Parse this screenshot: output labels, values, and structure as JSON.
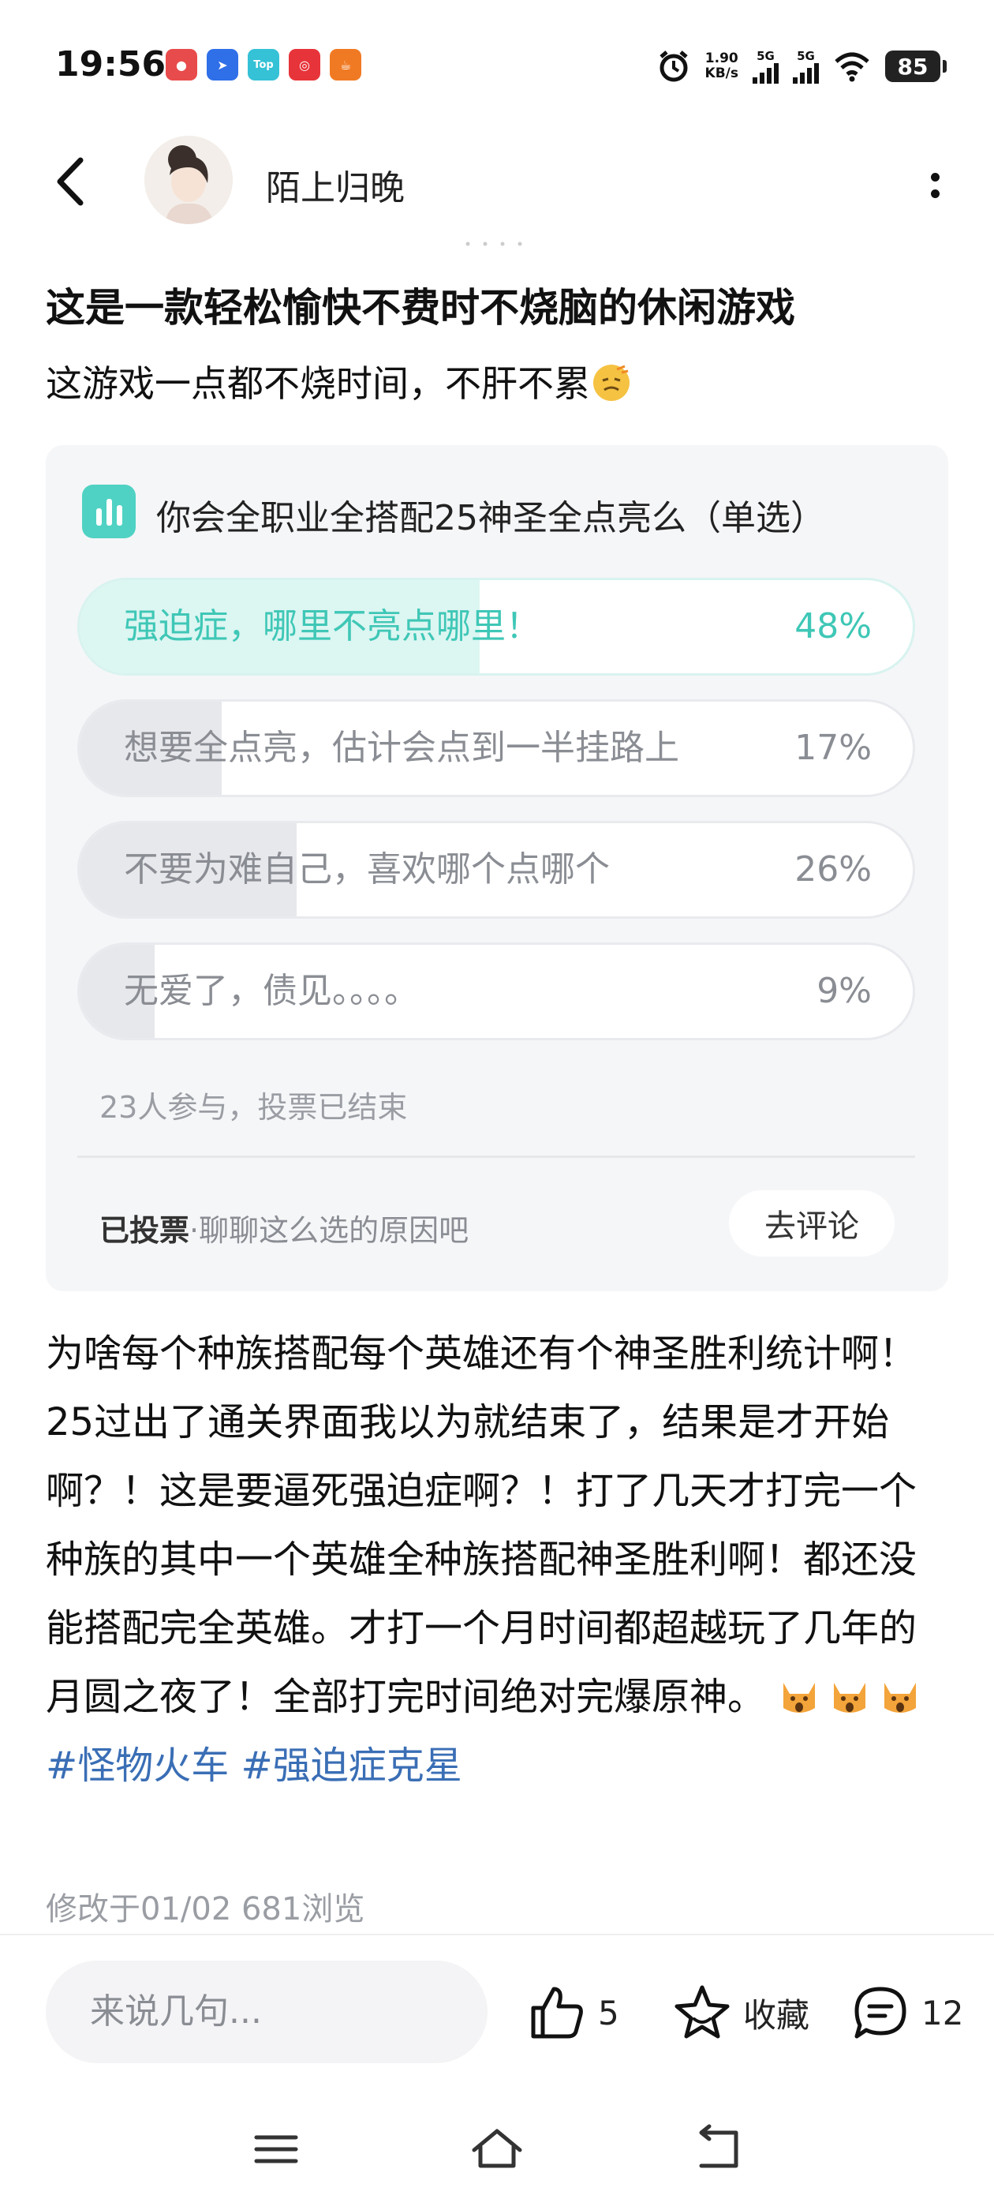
{
  "status_bar": {
    "time": "19:56",
    "net_speed_value": "1.90",
    "net_speed_unit": "KB/s",
    "sim1": "5G",
    "sim2": "5G",
    "battery": "85",
    "app_icons": [
      "grocery-app-icon",
      "navigation-app-icon",
      "top-app-icon",
      "music-app-icon",
      "cup-app-icon"
    ]
  },
  "header": {
    "username": "陌上归晚"
  },
  "post": {
    "title": "这是一款轻松愉快不费时不烧脑的休闲游戏",
    "subtitle": "这游戏一点都不烧时间，不肝不累"
  },
  "poll": {
    "question": "你会全职业全搭配25神圣全点亮么（单选）",
    "options": [
      {
        "label": "强迫症，哪里不亮点哪里！",
        "percent_text": "48%",
        "fraction": 0.48,
        "selected": true
      },
      {
        "label": "想要全点亮，估计会点到一半挂路上",
        "percent_text": "17%",
        "fraction": 0.17,
        "selected": false
      },
      {
        "label": "不要为难自己，喜欢哪个点哪个",
        "percent_text": "26%",
        "fraction": 0.26,
        "selected": false
      },
      {
        "label": "无爱了，债见。。。。",
        "percent_text": "9%",
        "fraction": 0.09,
        "selected": false
      }
    ],
    "meta": "23人参与，投票已结束",
    "voted_label": "已投票",
    "voted_hint": "·聊聊这么选的原因吧",
    "comment_button": "去评论"
  },
  "body": {
    "text": "为啥每个种族搭配每个英雄还有个神圣胜利统计啊！25过出了通关界面我以为就结束了，结果是才开始啊？！这是要逼死强迫症啊？！打了几天才打完一个种族的其中一个英雄全种族搭配神圣胜利啊！都还没能搭配完全英雄。才打一个月时间都超越玩了几年的月圆之夜了！全部打完时间绝对完爆原神。",
    "tags": [
      "#怪物火车",
      "#强迫症克星"
    ]
  },
  "footer": {
    "meta": "修改于01/02  681浏览"
  },
  "action_bar": {
    "input_placeholder": "来说几句...",
    "like_count": "5",
    "favorite_label": "收藏",
    "comment_count": "12"
  },
  "colors": {
    "accent": "#3fc7b6",
    "tag": "#3a6eb5",
    "card_bg": "#f5f6f8"
  }
}
